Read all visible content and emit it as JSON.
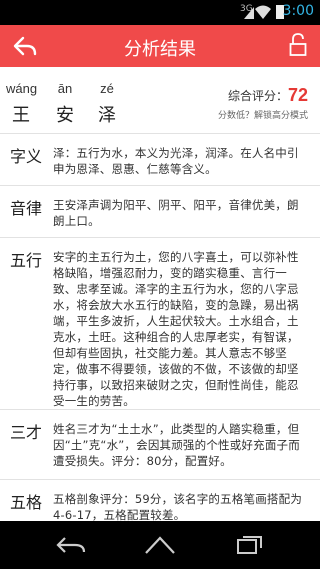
{
  "status_bar": {
    "signal_label": "3G",
    "time": "3:00"
  },
  "app_bar": {
    "title": "分析结果",
    "back_icon": "back-arrow-icon",
    "lock_icon": "lock-icon"
  },
  "name": {
    "characters": [
      {
        "pinyin": "wáng",
        "hanzi": "王"
      },
      {
        "pinyin": "ān",
        "hanzi": "安"
      },
      {
        "pinyin": "zé",
        "hanzi": "泽"
      }
    ],
    "score_label": "综合评分：",
    "score_value": "72",
    "score_hint": "分数低？解锁高分模式"
  },
  "sections": [
    {
      "heading": "字义",
      "text": "泽：五行为水，本义为光泽，润泽。在人名中引申为恩泽、恩惠、仁慈等含义。"
    },
    {
      "heading": "音律",
      "text": "王安泽声调为阳平、阴平、阳平，音律优美，朗朗上口。"
    },
    {
      "heading": "五行",
      "text": "安字的主五行为土，您的八字喜土，可以弥补性格缺陷，增强忍耐力，变的踏实稳重、言行一致、忠孝至诚。泽字的主五行为水，您的八字忌水，将会放大水五行的缺陷，变的急躁，易出祸端，平生多波折，人生起伏较大。土水组合，土克水，土旺。这种组合的人忠厚老实，有智谋，但却有些固执，社交能力差。其人意志不够坚定，做事不得要领，该做的不做，不该做的却坚持行事，以致招来破财之灾，但耐性尚佳，能忍受一生的劳苦。"
    },
    {
      "heading": "三才",
      "text": "姓名三才为“土土水”，此类型的人踏实稳重，但因“土”克“水”，会因其顽强的个性或好充面子而遭受损失。评分：80分，配置好。"
    },
    {
      "heading": "五格",
      "text": "五格剖象评分：59分，该名字的五格笔画搭配为4-6-17，五格配置较差。"
    }
  ],
  "colors": {
    "accent": "#f04a4a",
    "score": "#e53935",
    "status_clock": "#33b5e5"
  }
}
